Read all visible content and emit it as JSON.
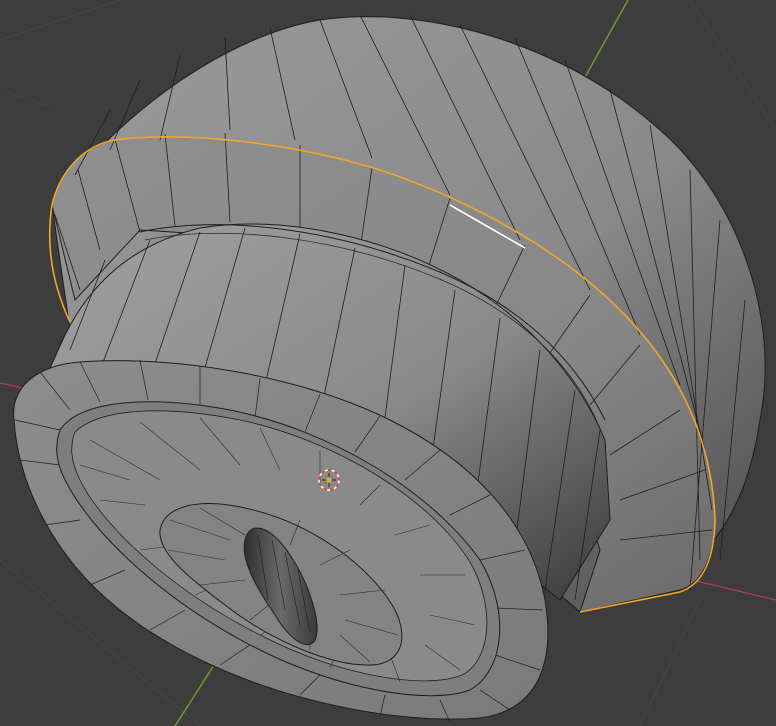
{
  "viewport": {
    "mode": "Edit Mode",
    "mesh": "pulley-mesh",
    "selection": "outer-flange-edge-loop"
  },
  "theme": {
    "background": "#3d3d3d",
    "grid_line": "#4a4a4a",
    "x_axis": "#b5434a",
    "y_axis": "#6e9a2d",
    "selected_edge": "#f2a72a",
    "active_edge": "#ffffff",
    "face": "#8c8c8c",
    "wire": "#1e1e1e"
  },
  "icons": {
    "cursor": "3d-cursor-icon"
  }
}
